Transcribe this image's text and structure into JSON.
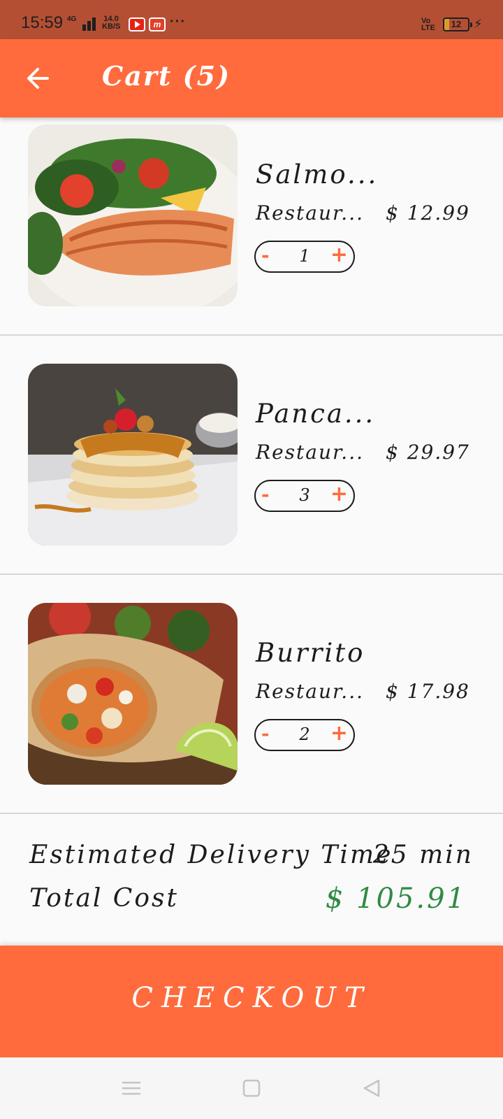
{
  "status_bar": {
    "time": "15:59",
    "network": "4G",
    "speed_value": "14.0",
    "speed_unit": "KB/S",
    "more": "···",
    "volte_top": "Vo",
    "volte_bottom": "LTE",
    "battery": "12"
  },
  "app_bar": {
    "title": "Cart (5)",
    "back_icon": "arrow-left-icon"
  },
  "items": [
    {
      "name": "Salmo...",
      "restaurant": "Restaur...",
      "price": "$ 12.99",
      "quantity": "1",
      "minus": "-",
      "plus": "+"
    },
    {
      "name": "Panca...",
      "restaurant": "Restaur...",
      "price": "$ 29.97",
      "quantity": "3",
      "minus": "-",
      "plus": "+"
    },
    {
      "name": "Burrito",
      "restaurant": "Restaur...",
      "price": "$ 17.98",
      "quantity": "2",
      "minus": "-",
      "plus": "+"
    }
  ],
  "summary": {
    "delivery_label": "Estimated Delivery Time",
    "delivery_value": "25 min",
    "total_label": "Total Cost",
    "total_value": "$ 105.91"
  },
  "checkout": {
    "label": "CHECKOUT"
  },
  "colors": {
    "accent": "#ff6b3d",
    "status_bar": "#b44f34",
    "total_green": "#2e8b42"
  },
  "nav_bar": {
    "icons": [
      "menu-icon",
      "home-square-icon",
      "back-triangle-icon"
    ]
  }
}
